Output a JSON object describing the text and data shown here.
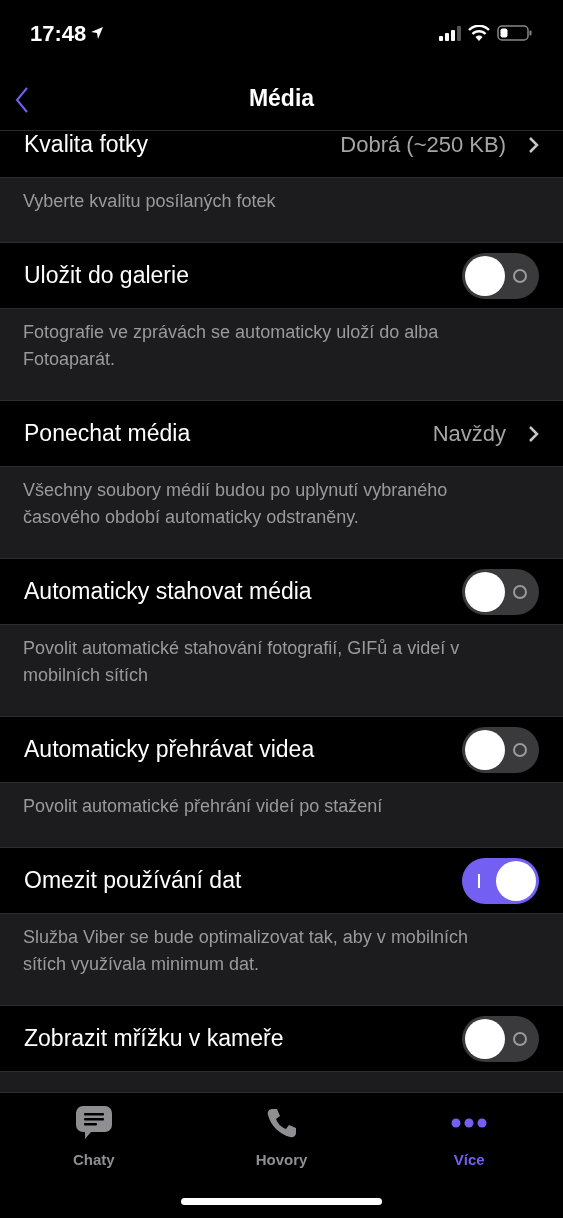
{
  "status_bar": {
    "time": "17:48"
  },
  "nav": {
    "title": "Média"
  },
  "rows": [
    {
      "kind": "value",
      "label": "Kvalita fotky",
      "value": "Dobrá (~250 KB)",
      "footer": "Vyberte kvalitu posílaných fotek"
    },
    {
      "kind": "toggle",
      "label": "Uložit do galerie",
      "on": false,
      "footer": "Fotografie ve zprávách se automaticky uloží do alba Fotoaparát."
    },
    {
      "kind": "value",
      "label": "Ponechat média",
      "value": "Navždy",
      "footer": "Všechny soubory médií budou po uplynutí vybraného časového období automaticky odstraněny."
    },
    {
      "kind": "toggle",
      "label": "Automaticky stahovat média",
      "on": false,
      "footer": "Povolit automatické stahování fotografií, GIFů a videí v mobilních sítích"
    },
    {
      "kind": "toggle",
      "label": "Automaticky přehrávat videa",
      "on": false,
      "footer": "Povolit automatické přehrání videí po stažení"
    },
    {
      "kind": "toggle",
      "label": "Omezit používání dat",
      "on": true,
      "footer": "Služba Viber se bude optimalizovat tak, aby v mobilních sítích využívala minimum dat."
    },
    {
      "kind": "toggle",
      "label": "Zobrazit mřížku v kameře",
      "on": false
    }
  ],
  "tabs": [
    {
      "kind": "chat",
      "label": "Chaty",
      "selected": false
    },
    {
      "kind": "call",
      "label": "Hovory",
      "selected": false
    },
    {
      "kind": "more",
      "label": "Více",
      "selected": true
    }
  ]
}
